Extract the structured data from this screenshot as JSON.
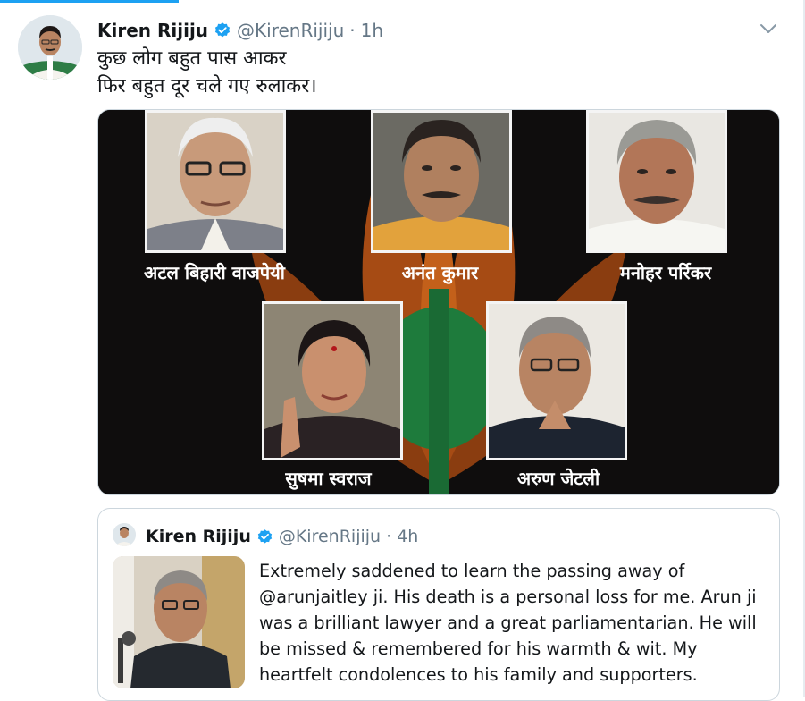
{
  "tweet": {
    "author_name": "Kiren Rijiju",
    "handle": "@KirenRijiju",
    "separator": "·",
    "time": "1h",
    "text_lines": [
      "कुछ लोग बहुत पास आकर",
      "फिर बहुत दूर चले गए रुलाकर।"
    ],
    "media": {
      "captions": [
        "अटल बिहारी वाजपेयी",
        "अनंत कुमार",
        "मनोहर पर्रिकर",
        "सुषमा स्वराज",
        "अरुण जेटली"
      ],
      "colors": {
        "background": "#0f0d0d",
        "saffron": "#e97a1d",
        "green": "#1e7b3c"
      }
    }
  },
  "quoted_tweet": {
    "author_name": "Kiren Rijiju",
    "handle": "@KirenRijiju",
    "separator": "·",
    "time": "4h",
    "text": "Extremely saddened to learn the passing away of @arunjaitley ji. His death is a personal loss for me. Arun ji was a brilliant lawyer and a great parliamentarian. He will be missed & remembered for his warmth & wit. My heartfelt condolences to his family and supporters."
  },
  "icons": {
    "verified": "verified-badge-icon",
    "caret": "chevron-down-icon"
  },
  "colors": {
    "accent": "#1da1f2",
    "text": "#14171a",
    "muted": "#657786",
    "border": "#ccd6dd"
  }
}
